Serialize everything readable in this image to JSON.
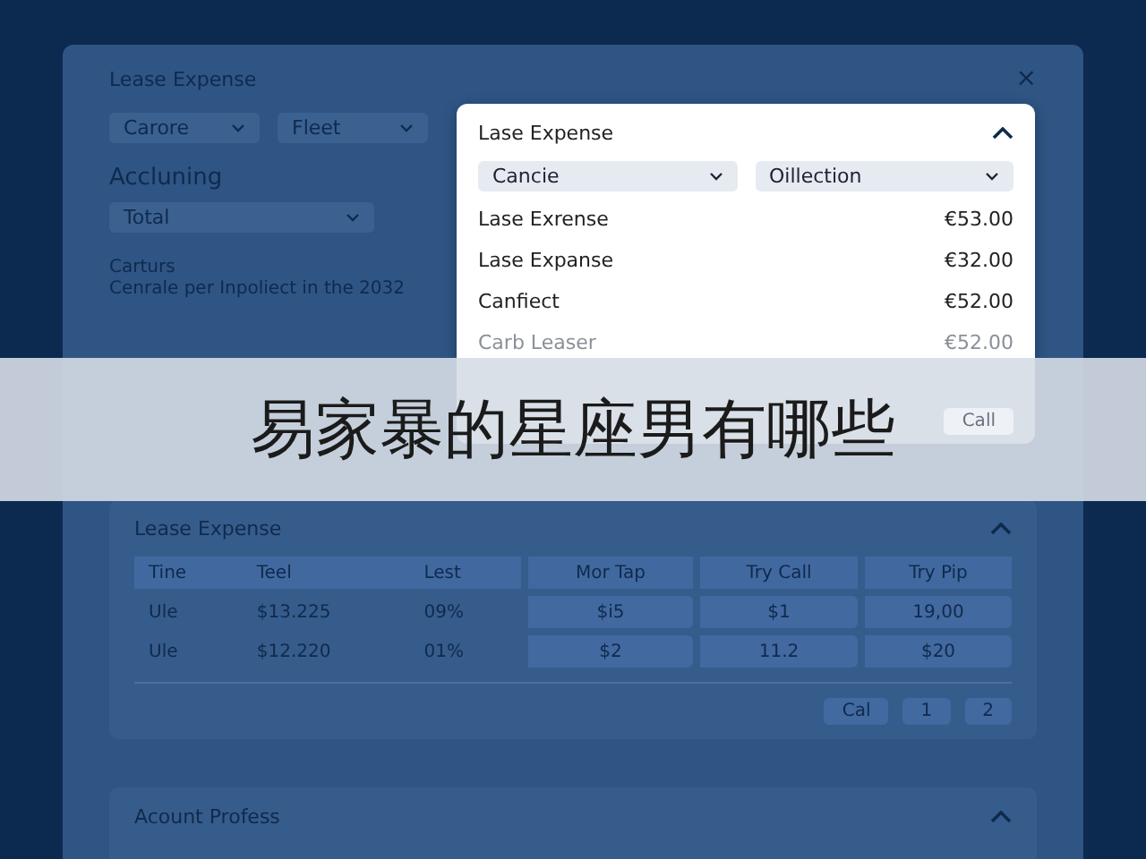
{
  "window": {
    "title": "Lease Expense",
    "close": "×"
  },
  "filters": [
    {
      "label": "Carore"
    },
    {
      "label": "Fleet"
    }
  ],
  "accounting": {
    "heading": "Accluning",
    "select": "Total"
  },
  "note": {
    "title": "Carturs",
    "text": "Cenrale per Inpoliect in the 2032"
  },
  "popup": {
    "title": "Lase Expense",
    "selects": [
      "Cancie",
      "Oillection"
    ],
    "rows": [
      {
        "label": "Lase Exrense",
        "amount": "€53.00",
        "disabled": false
      },
      {
        "label": "Lase Expanse",
        "amount": "€32.00",
        "disabled": false
      },
      {
        "label": "Canfiect",
        "amount": "€52.00",
        "disabled": false
      },
      {
        "label": "Carb Leaser",
        "amount": "€52.00",
        "disabled": true
      }
    ],
    "button": "Call"
  },
  "table_section": {
    "title": "Lease Expense",
    "columns": [
      {
        "label": "Tine",
        "boxed": false
      },
      {
        "label": "Teel",
        "boxed": false
      },
      {
        "label": "Lest",
        "boxed": false
      },
      {
        "label": "Mor Tap",
        "boxed": true
      },
      {
        "label": "Try Call",
        "boxed": true
      },
      {
        "label": "Try Pip",
        "boxed": true
      }
    ],
    "rows": [
      [
        "Ule",
        "$13.225",
        "09%",
        "$i5",
        "$1",
        "19,00"
      ],
      [
        "Ule",
        "$12.220",
        "01%",
        "$2",
        "11.2",
        "$20"
      ]
    ],
    "pagination": [
      "Cal",
      "1",
      "2"
    ]
  },
  "account_section": {
    "title": "Acount Profess"
  },
  "overlay_banner": {
    "text": "易家暴的星座男有哪些"
  }
}
